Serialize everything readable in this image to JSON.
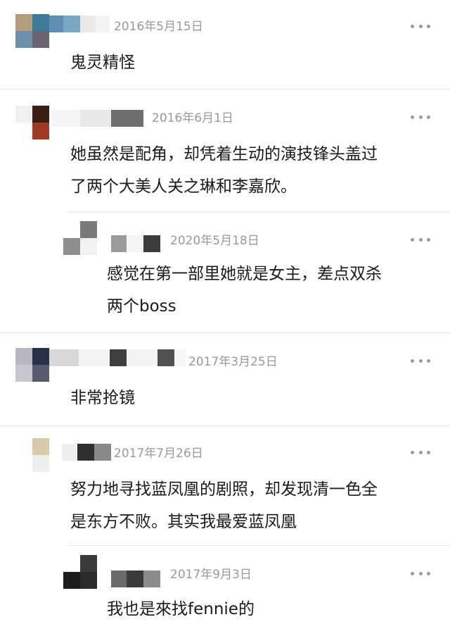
{
  "comments": [
    {
      "date": "2016年5月15日",
      "text": [
        "鬼灵精怪"
      ]
    },
    {
      "date": "2016年6月1日",
      "text": [
        "她虽然是配角，却凭着生动的演技锋头盖过",
        "了两个大美人关之琳和李嘉欣。"
      ]
    },
    {
      "date": "2020年5月18日",
      "text": [
        "感觉在第一部里她就是女主，差点双杀",
        "两个boss"
      ]
    },
    {
      "date": "2017年3月25日",
      "text": [
        "非常抢镜"
      ]
    },
    {
      "date": "2017年7月26日",
      "text": [
        "努力地寻找蓝凤凰的剧照，却发现清一色全",
        "是东方不败。其实我最爱蓝凤凰"
      ]
    },
    {
      "date": "2017年9月3日",
      "text": [
        "我也是來找fennie的"
      ]
    }
  ],
  "icons": {
    "more": "more-dots-icon",
    "avatar": "avatar-image"
  },
  "colors": {
    "date": "#999999",
    "text": "#1a1a1a",
    "divider": "#e6e6e6",
    "more": "#9a9a9a"
  }
}
